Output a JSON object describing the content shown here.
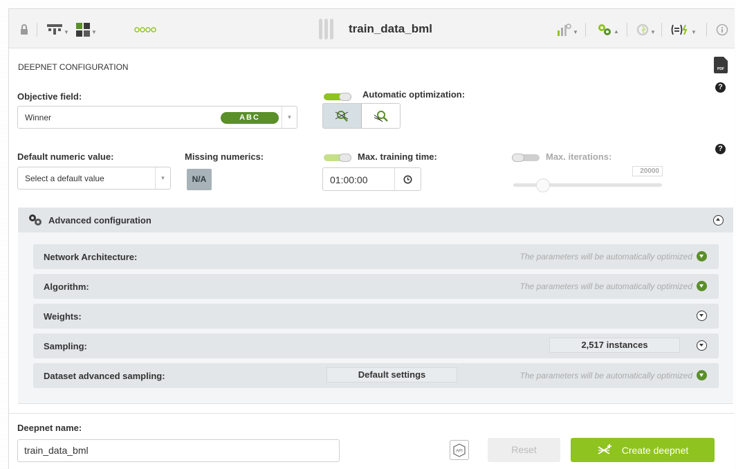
{
  "toolbar": {
    "title": "train_data_bml"
  },
  "section": {
    "title": "DEEPNET CONFIGURATION",
    "pdf_label": "PDF"
  },
  "objective": {
    "label": "Objective field:",
    "value": "Winner",
    "type_badge": "ABC"
  },
  "auto_opt": {
    "label": "Automatic optimization:",
    "enabled": true
  },
  "default_numeric": {
    "label": "Default numeric value:",
    "placeholder": "Select a default value"
  },
  "missing_numerics": {
    "label": "Missing numerics:",
    "badge": "N/A"
  },
  "max_training_time": {
    "label": "Max. training time:",
    "value": "01:00:00",
    "enabled": true
  },
  "max_iterations": {
    "label": "Max. iterations:",
    "value": "20000",
    "enabled": false
  },
  "help_glyph": "?",
  "advanced": {
    "title": "Advanced configuration",
    "rows": [
      {
        "label": "Network Architecture:",
        "note": "The parameters will be automatically optimized"
      },
      {
        "label": "Algorithm:",
        "note": "The parameters will be automatically optimized"
      },
      {
        "label": "Weights:"
      },
      {
        "label": "Sampling:",
        "value": "2,517 instances"
      },
      {
        "label": "Dataset advanced sampling:",
        "value": "Default settings",
        "note": "The parameters will be automatically optimized"
      }
    ]
  },
  "footer": {
    "name_label": "Deepnet name:",
    "name_value": "train_data_bml",
    "api_label": "API",
    "reset_label": "Reset",
    "create_label": "Create deepnet"
  },
  "colors": {
    "accent_green": "#8fc31f",
    "dark_green": "#5a8f29",
    "row_bg": "#e2e6e8"
  }
}
